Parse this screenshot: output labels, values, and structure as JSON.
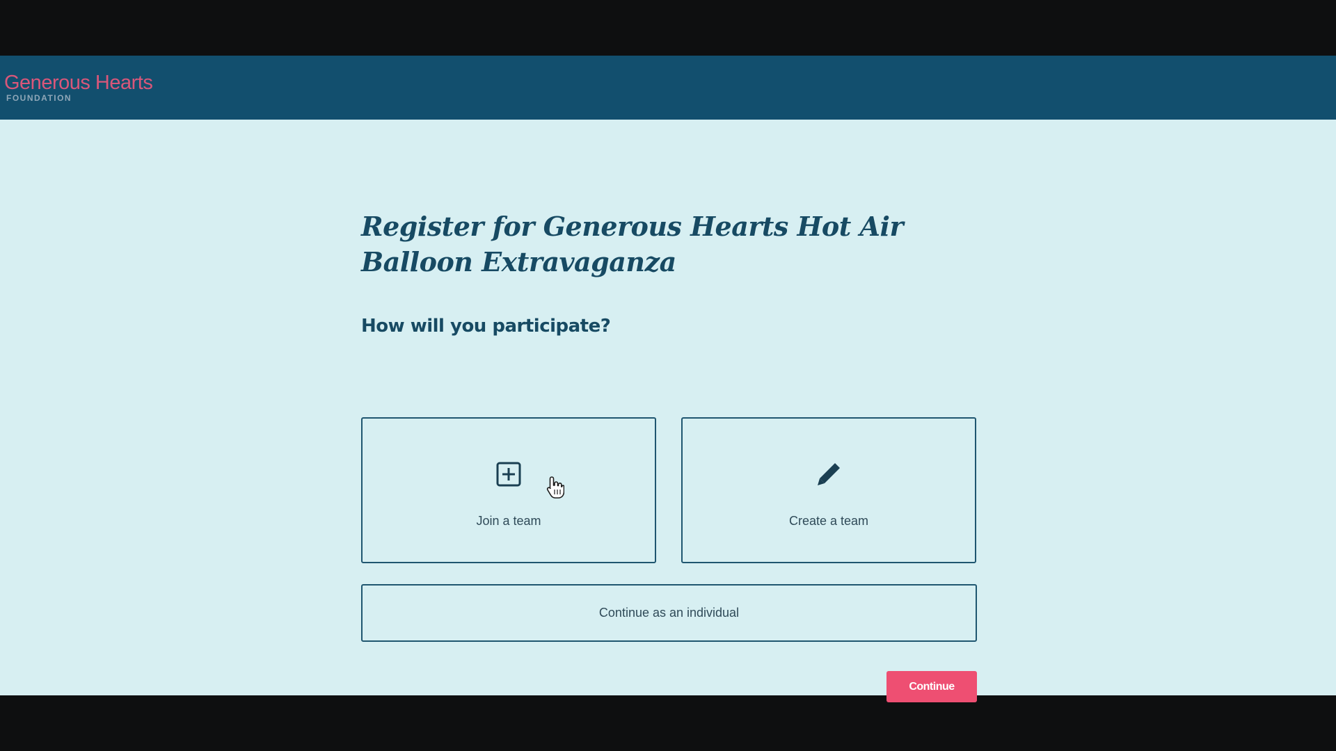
{
  "header": {
    "logo_name": "Generous Hearts",
    "logo_sub": "FOUNDATION"
  },
  "page": {
    "title": "Register for Generous Hearts Hot Air Balloon Extravaganza",
    "question": "How will you participate?"
  },
  "options": [
    {
      "label": "Join a team",
      "icon": "plus-square-icon"
    },
    {
      "label": "Create a team",
      "icon": "pencil-icon"
    }
  ],
  "individual_label": "Continue as an individual",
  "continue_label": "Continue",
  "colors": {
    "header_bg": "#124f6e",
    "page_bg": "#d7eff2",
    "brand_pink": "#ee4f72",
    "heading": "#174a63"
  }
}
